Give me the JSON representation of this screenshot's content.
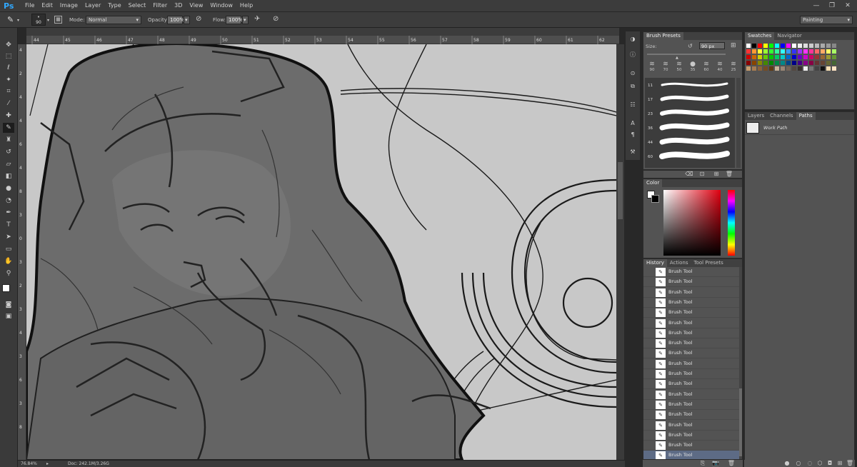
{
  "app": {
    "logo": "Ps"
  },
  "menu": [
    "File",
    "Edit",
    "Image",
    "Layer",
    "Type",
    "Select",
    "Filter",
    "3D",
    "View",
    "Window",
    "Help"
  ],
  "window_controls": {
    "minimize": "—",
    "maximize": "❐",
    "close": "✕"
  },
  "options": {
    "brush_size": "90",
    "mode_label": "Mode:",
    "mode_value": "Normal",
    "opacity_label": "Opacity:",
    "opacity_value": "100%",
    "flow_label": "Flow:",
    "flow_value": "100%",
    "workspace": "Painting"
  },
  "ruler": {
    "h_ticks": [
      "44",
      "45",
      "46",
      "47",
      "48",
      "49",
      "50",
      "51",
      "52",
      "53",
      "54",
      "55",
      "56",
      "57",
      "58",
      "59",
      "60",
      "61",
      "62"
    ],
    "v_ticks": [
      "4",
      "2",
      "4",
      "4",
      "6",
      "4",
      "8",
      "3",
      "0",
      "3",
      "2",
      "3",
      "4",
      "3",
      "6",
      "3",
      "8"
    ]
  },
  "status": {
    "zoom": "76.84%",
    "doc": "Doc: 242.1M/3.26G"
  },
  "brush_presets": {
    "tab": "Brush Presets",
    "size_label": "Size:",
    "size_value": "90 px",
    "tips": [
      "90",
      "70",
      "50",
      "35",
      "60",
      "40",
      "25"
    ],
    "list_sizes": [
      "11",
      "17",
      "23",
      "36",
      "44",
      "60"
    ]
  },
  "swatches_panel": {
    "tabs": [
      "Swatches",
      "Navigator"
    ]
  },
  "color_panel": {
    "tab": "Color"
  },
  "layers_panel": {
    "tabs": [
      "Layers",
      "Channels",
      "Paths"
    ],
    "path_name": "Work Path"
  },
  "history_panel": {
    "tabs": [
      "History",
      "Actions",
      "Tool Presets"
    ],
    "items": [
      "Brush Tool",
      "Brush Tool",
      "Brush Tool",
      "Brush Tool",
      "Brush Tool",
      "Brush Tool",
      "Brush Tool",
      "Brush Tool",
      "Brush Tool",
      "Brush Tool",
      "Brush Tool",
      "Brush Tool",
      "Brush Tool",
      "Brush Tool",
      "Brush Tool",
      "Brush Tool",
      "Brush Tool",
      "Brush Tool",
      "Brush Tool"
    ]
  },
  "tools": [
    "move-tool",
    "marquee-tool",
    "lasso-tool",
    "quick-select-tool",
    "crop-tool",
    "eyedropper-tool",
    "healing-tool",
    "brush-tool",
    "clone-stamp-tool",
    "history-brush-tool",
    "eraser-tool",
    "gradient-tool",
    "blur-tool",
    "dodge-tool",
    "pen-tool",
    "type-tool",
    "path-select-tool",
    "shape-tool",
    "hand-tool",
    "zoom-tool"
  ],
  "colors": {
    "accent": "#31a8ff",
    "selection": "#5d6b85",
    "canvas_bg": "#c8c8c8"
  }
}
